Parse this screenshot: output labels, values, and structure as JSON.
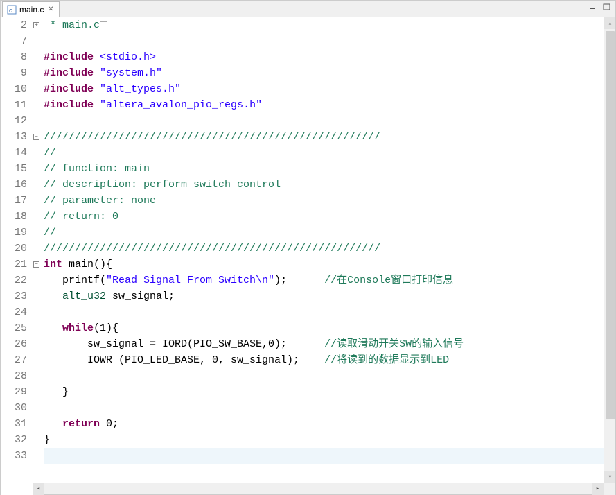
{
  "tab": {
    "filename": "main.c",
    "active": true
  },
  "code": {
    "lines": [
      {
        "n": 2,
        "fold": "plus",
        "tokens": [
          {
            "c": "cmt",
            "t": " * main.c"
          },
          {
            "c": "dimbox",
            "t": " "
          }
        ]
      },
      {
        "n": 7,
        "tokens": []
      },
      {
        "n": 8,
        "tokens": [
          {
            "c": "kw-pp",
            "t": "#include"
          },
          {
            "c": "plain",
            "t": " "
          },
          {
            "c": "inc",
            "t": "<stdio.h>"
          }
        ]
      },
      {
        "n": 9,
        "tokens": [
          {
            "c": "kw-pp",
            "t": "#include"
          },
          {
            "c": "plain",
            "t": " "
          },
          {
            "c": "inc",
            "t": "\"system.h\""
          }
        ]
      },
      {
        "n": 10,
        "tokens": [
          {
            "c": "kw-pp",
            "t": "#include"
          },
          {
            "c": "plain",
            "t": " "
          },
          {
            "c": "inc",
            "t": "\"alt_types.h\""
          }
        ]
      },
      {
        "n": 11,
        "tokens": [
          {
            "c": "kw-pp",
            "t": "#include"
          },
          {
            "c": "plain",
            "t": " "
          },
          {
            "c": "inc",
            "t": "\"altera_avalon_pio_regs.h\""
          }
        ]
      },
      {
        "n": 12,
        "tokens": []
      },
      {
        "n": 13,
        "fold": "minus",
        "tokens": [
          {
            "c": "cmt",
            "t": "//////////////////////////////////////////////////////"
          }
        ]
      },
      {
        "n": 14,
        "tokens": [
          {
            "c": "cmt",
            "t": "//"
          }
        ]
      },
      {
        "n": 15,
        "tokens": [
          {
            "c": "cmt",
            "t": "// function: main"
          }
        ]
      },
      {
        "n": 16,
        "tokens": [
          {
            "c": "cmt",
            "t": "// description: perform switch control"
          }
        ]
      },
      {
        "n": 17,
        "tokens": [
          {
            "c": "cmt",
            "t": "// parameter: none"
          }
        ]
      },
      {
        "n": 18,
        "tokens": [
          {
            "c": "cmt",
            "t": "// return: 0"
          }
        ]
      },
      {
        "n": 19,
        "tokens": [
          {
            "c": "cmt",
            "t": "//"
          }
        ]
      },
      {
        "n": 20,
        "tokens": [
          {
            "c": "cmt",
            "t": "//////////////////////////////////////////////////////"
          }
        ]
      },
      {
        "n": 21,
        "fold": "minus",
        "tokens": [
          {
            "c": "kw",
            "t": "int"
          },
          {
            "c": "plain",
            "t": " "
          },
          {
            "c": "plain",
            "t": "main(){"
          }
        ]
      },
      {
        "n": 22,
        "tokens": [
          {
            "c": "plain",
            "t": "   printf("
          },
          {
            "c": "str",
            "t": "\"Read Signal From Switch\\n\""
          },
          {
            "c": "plain",
            "t": ");      "
          },
          {
            "c": "cmt",
            "t": "//在Console窗口打印信息"
          }
        ]
      },
      {
        "n": 23,
        "tokens": [
          {
            "c": "plain",
            "t": "   "
          },
          {
            "c": "typ",
            "t": "alt_u32"
          },
          {
            "c": "plain",
            "t": " sw_signal;"
          }
        ]
      },
      {
        "n": 24,
        "tokens": []
      },
      {
        "n": 25,
        "tokens": [
          {
            "c": "plain",
            "t": "   "
          },
          {
            "c": "kw",
            "t": "while"
          },
          {
            "c": "plain",
            "t": "(1){"
          }
        ]
      },
      {
        "n": 26,
        "tokens": [
          {
            "c": "plain",
            "t": "       sw_signal = IORD(PIO_SW_BASE,0);      "
          },
          {
            "c": "cmt",
            "t": "//读取滑动开关SW的输入信号"
          }
        ]
      },
      {
        "n": 27,
        "tokens": [
          {
            "c": "plain",
            "t": "       IOWR (PIO_LED_BASE, 0, sw_signal);    "
          },
          {
            "c": "cmt",
            "t": "//将读到的数据显示到LED"
          }
        ]
      },
      {
        "n": 28,
        "tokens": []
      },
      {
        "n": 29,
        "tokens": [
          {
            "c": "plain",
            "t": "   }"
          }
        ]
      },
      {
        "n": 30,
        "tokens": []
      },
      {
        "n": 31,
        "tokens": [
          {
            "c": "plain",
            "t": "   "
          },
          {
            "c": "kw",
            "t": "return"
          },
          {
            "c": "plain",
            "t": " 0;"
          }
        ]
      },
      {
        "n": 32,
        "tokens": [
          {
            "c": "plain",
            "t": "}"
          }
        ]
      },
      {
        "n": 33,
        "cursor": true,
        "tokens": []
      }
    ]
  }
}
